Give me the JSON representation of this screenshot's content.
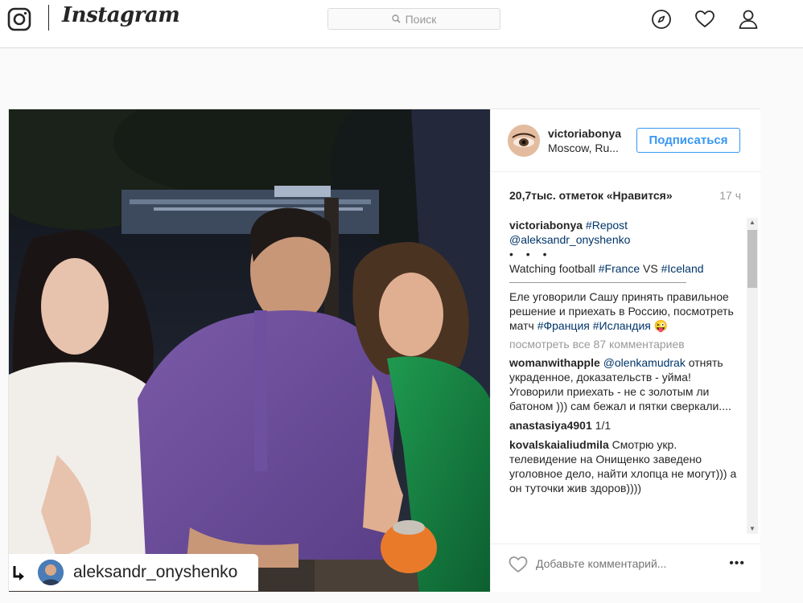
{
  "nav": {
    "wordmark": "Instagram",
    "search_placeholder": "Поиск",
    "icons": [
      "instagram-logo-icon",
      "search-icon",
      "explore-compass-icon",
      "heart-icon",
      "profile-icon"
    ]
  },
  "post": {
    "repost_username": "aleksandr_onyshenko",
    "author": {
      "username": "victoriabonya",
      "location": "Moscow, Ru..."
    },
    "follow_label": "Подписаться",
    "likes_text": "20,7тыс. отметок «Нравится»",
    "time_ago": "17 ч",
    "caption": {
      "username": "victoriabonya",
      "repost_tag": "#Repost",
      "mention": "@aleksandr_onyshenko",
      "dots": "• • •",
      "line_watching": "Watching football ",
      "tag_france": "#France",
      "vs": " VS ",
      "tag_iceland": "#Iceland",
      "line_ru": "Еле уговорили Сашу принять правильное решение и приехать в Россию, посмотреть матч ",
      "tag_france_ru": "#Франция",
      "tag_iceland_ru": "#Исландия",
      "emoji": "😜"
    },
    "view_all_comments": "посмотреть все 87 комментариев",
    "comments": [
      {
        "username": "womanwithapple",
        "mention": "@olenkamudrak",
        "text": "отнять украденное, доказательств - уйма! Уговорили приехать - не с золотым ли батоном ))) сам бежал и пятки сверкали...."
      },
      {
        "username": "anastasiya4901",
        "text": "1/1"
      },
      {
        "username": "kovalskaialiudmila",
        "text": "Смотрю укр. телевидение на Онищенко заведено уголовное дело, найти хлопца не могут))) а он туточки жив здоров))))"
      }
    ],
    "add_comment_placeholder": "Добавьте комментарий...",
    "more_label": "•••"
  },
  "colors": {
    "link_blue": "#003569",
    "follow_blue": "#3897f0",
    "muted": "#999999"
  }
}
